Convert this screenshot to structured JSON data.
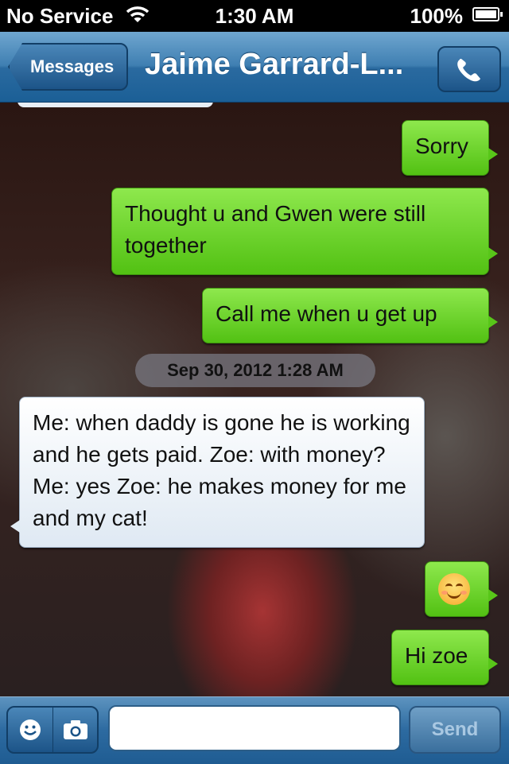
{
  "status_bar": {
    "carrier": "No Service",
    "time": "1:30 AM",
    "battery": "100%"
  },
  "nav": {
    "back_label": "Messages",
    "title": "Jaime Garrard-L..."
  },
  "messages": [
    {
      "direction": "outgoing",
      "text": "Sorry"
    },
    {
      "direction": "outgoing",
      "text": "Thought u and Gwen were still together"
    },
    {
      "direction": "outgoing",
      "text": "Call me when u get up"
    },
    {
      "direction": "incoming",
      "text": "Me: when daddy is gone he is working and he gets paid. Zoe: with money? Me: yes Zoe: he makes money for me and my cat!"
    },
    {
      "direction": "outgoing",
      "text": "smiling-face-emoji"
    },
    {
      "direction": "outgoing",
      "text": "Hi zoe"
    }
  ],
  "timestamp": "Sep 30, 2012 1:28 AM",
  "input": {
    "placeholder": "",
    "send_label": "Send"
  },
  "colors": {
    "outgoing_bubble": "#5ccb1a",
    "incoming_bubble": "#e6eef6",
    "nav_bar": "#2a6aa0"
  }
}
